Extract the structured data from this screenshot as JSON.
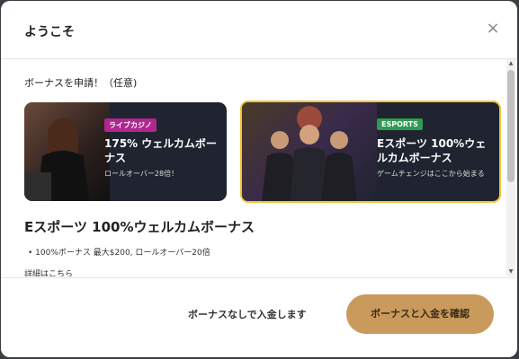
{
  "modal": {
    "title": "ようこそ",
    "close_label": "×"
  },
  "body": {
    "section_label": "ボーナスを申請！（任意)",
    "cards": [
      {
        "tag": "ライブカジノ",
        "title": "175% ウェルカムボーナス",
        "subtitle": "ロールオーバー28倍！",
        "tag_color": "#b1268f"
      },
      {
        "tag": "ESPORTS",
        "title": "Eスポーツ 100%ウェルカムボーナス",
        "subtitle": "ゲームチェンジはここから始まる",
        "tag_color": "#2f9a52",
        "selected": true
      }
    ],
    "bonus_title": "Eスポーツ 100%ウェルカムボーナス",
    "bullet": "100%ボーナス 最大$200, ロールオーバー20倍",
    "details_label": "詳細はこちら"
  },
  "footer": {
    "secondary_label": "ボーナスなしで入金します",
    "primary_label": "ボーナスと入金を確認"
  },
  "colors": {
    "primary_button": "#c99a5b",
    "selected_border": "#f0c534"
  }
}
